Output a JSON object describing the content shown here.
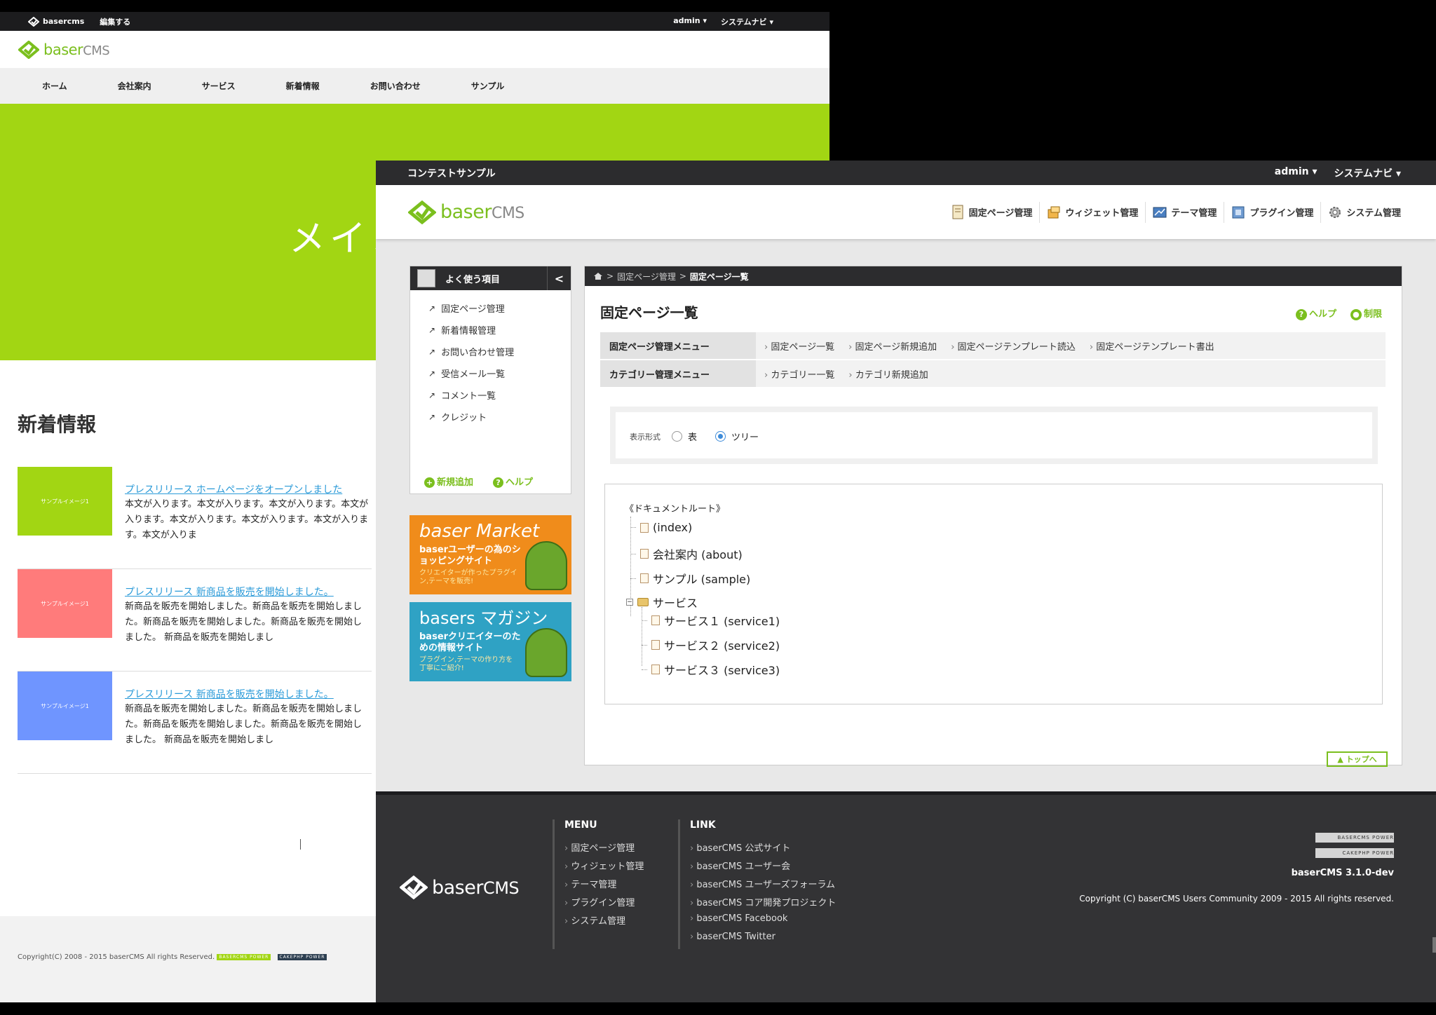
{
  "site": {
    "topbar": {
      "logo": "basercms",
      "edit": "編集する",
      "user": "admin ▾",
      "sysnav": "システムナビ ▾"
    },
    "logo": {
      "brand": "baser",
      "suffix": "CMS"
    },
    "nav": [
      "ホーム",
      "会社案内",
      "サービス",
      "新着情報",
      "お問い合わせ",
      "サンプル"
    ],
    "hero_text": "メイン",
    "news_title": "新着情報",
    "news": [
      {
        "thumb": "サンプルイメージ1",
        "color": "#a2d613",
        "link": "プレスリリース ホームページをオープンしました",
        "body": "本文が入ります。本文が入ります。本文が入ります。本文が入ります。本文が入ります。本文が入ります。本文が入ります。本文が入りま"
      },
      {
        "thumb": "サンプルイメージ1",
        "color": "#ff7b7b",
        "link": "プレスリリース 新商品を販売を開始しました。",
        "body": "新商品を販売を開始しました。新商品を販売を開始しました。新商品を販売を開始しました。新商品を販売を開始しました。 新商品を販売を開始しまし"
      },
      {
        "thumb": "サンプルイメージ1",
        "color": "#6f95ff",
        "link": "プレスリリース 新商品を販売を開始しました。",
        "body": "新商品を販売を開始しました。新商品を販売を開始しました。新商品を販売を開始しました。新商品を販売を開始しました。 新商品を販売を開始しまし"
      }
    ],
    "footer_copy": "Copyright(C) 2008 - 2015 baserCMS All rights Reserved.",
    "badge1": "BASERCMS POWER",
    "badge2": "CAKEPHP POWER"
  },
  "admin": {
    "topbar": {
      "title": "コンテストサンプル",
      "user": "admin ▾",
      "sysnav": "システムナビ ▾"
    },
    "logo": {
      "brand": "baser",
      "suffix": "CMS"
    },
    "menu": [
      "固定ページ管理",
      "ウィジェット管理",
      "テーマ管理",
      "プラグイン管理",
      "システム管理"
    ],
    "favorites": {
      "title": "よく使う項目",
      "collapse": "<",
      "items": [
        "固定ページ管理",
        "新着情報管理",
        "お問い合わせ管理",
        "受信メール一覧",
        "コメント一覧",
        "クレジット"
      ],
      "add": "新規追加",
      "help": "ヘルプ"
    },
    "banner_market": {
      "big": "baser Market",
      "mid": "baserユーザーの為のショッピングサイト",
      "small": "クリエイターが作ったプラグイン,テーマを販売!"
    },
    "banner_magazine": {
      "big": "basers マガジン",
      "mid": "baserクリエイターのための情報サイト",
      "small": "プラグイン,テーマの作り方を丁寧にご紹介!"
    },
    "breadcrumb": {
      "sep": ">",
      "parent": "固定ページ管理",
      "current": "固定ページ一覧"
    },
    "page_title": "固定ページ一覧",
    "help": "ヘルプ",
    "restrict": "制限",
    "page_menu": {
      "label": "固定ページ管理メニュー",
      "items": [
        "固定ページ一覧",
        "固定ページ新規追加",
        "固定ページテンプレート読込",
        "固定ページテンプレート書出"
      ]
    },
    "cat_menu": {
      "label": "カテゴリー管理メニュー",
      "items": [
        "カテゴリー一覧",
        "カテゴリ新規追加"
      ]
    },
    "view_mode": {
      "label": "表示形式",
      "opt_table": "表",
      "opt_tree": "ツリー",
      "selected": "ツリー"
    },
    "tree": {
      "root": "《ドキュメントルート》",
      "nodes": [
        "(index)",
        "会社案内 (about)",
        "サンプル (sample)"
      ],
      "folder": "サービス",
      "children": [
        "サービス１ (service1)",
        "サービス２ (service2)",
        "サービス３ (service3)"
      ]
    },
    "to_top": "▲ トップへ",
    "footer": {
      "menu_title": "MENU",
      "menu": [
        "固定ページ管理",
        "ウィジェット管理",
        "テーマ管理",
        "プラグイン管理",
        "システム管理"
      ],
      "link_title": "LINK",
      "links": [
        "baserCMS 公式サイト",
        "baserCMS ユーザー会",
        "baserCMS ユーザーズフォーラム",
        "baserCMS コア開発プロジェクト",
        "baserCMS Facebook",
        "baserCMS Twitter"
      ],
      "badge1": "BASERCMS  POWER",
      "badge2": "CAKEPHP  POWER",
      "version": "baserCMS 3.1.0-dev",
      "copyright": "Copyright (C) baserCMS Users Community 2009 - 2015 All rights reserved."
    }
  },
  "colors": {
    "brand_green": "#7bbf1e",
    "hero_green": "#a2d613",
    "dark_bar": "#2c2c2e",
    "link_blue": "#2a9ad8"
  }
}
